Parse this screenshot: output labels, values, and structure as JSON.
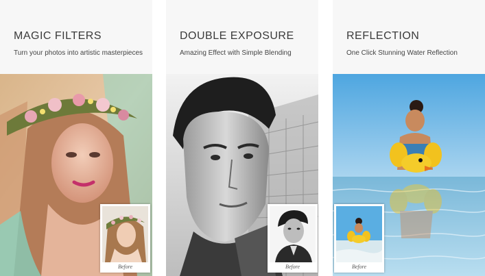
{
  "panels": [
    {
      "title": "MAGIC FILTERS",
      "subtitle": "Turn your photos into artistic masterpieces",
      "thumb_label": "Before"
    },
    {
      "title": "DOUBLE EXPOSURE",
      "subtitle": "Amazing Effect with Simple Blending",
      "thumb_label": "Before"
    },
    {
      "title": "REFLECTION",
      "subtitle": "One Click Stunning Water Reflection",
      "thumb_label": "Before"
    }
  ]
}
